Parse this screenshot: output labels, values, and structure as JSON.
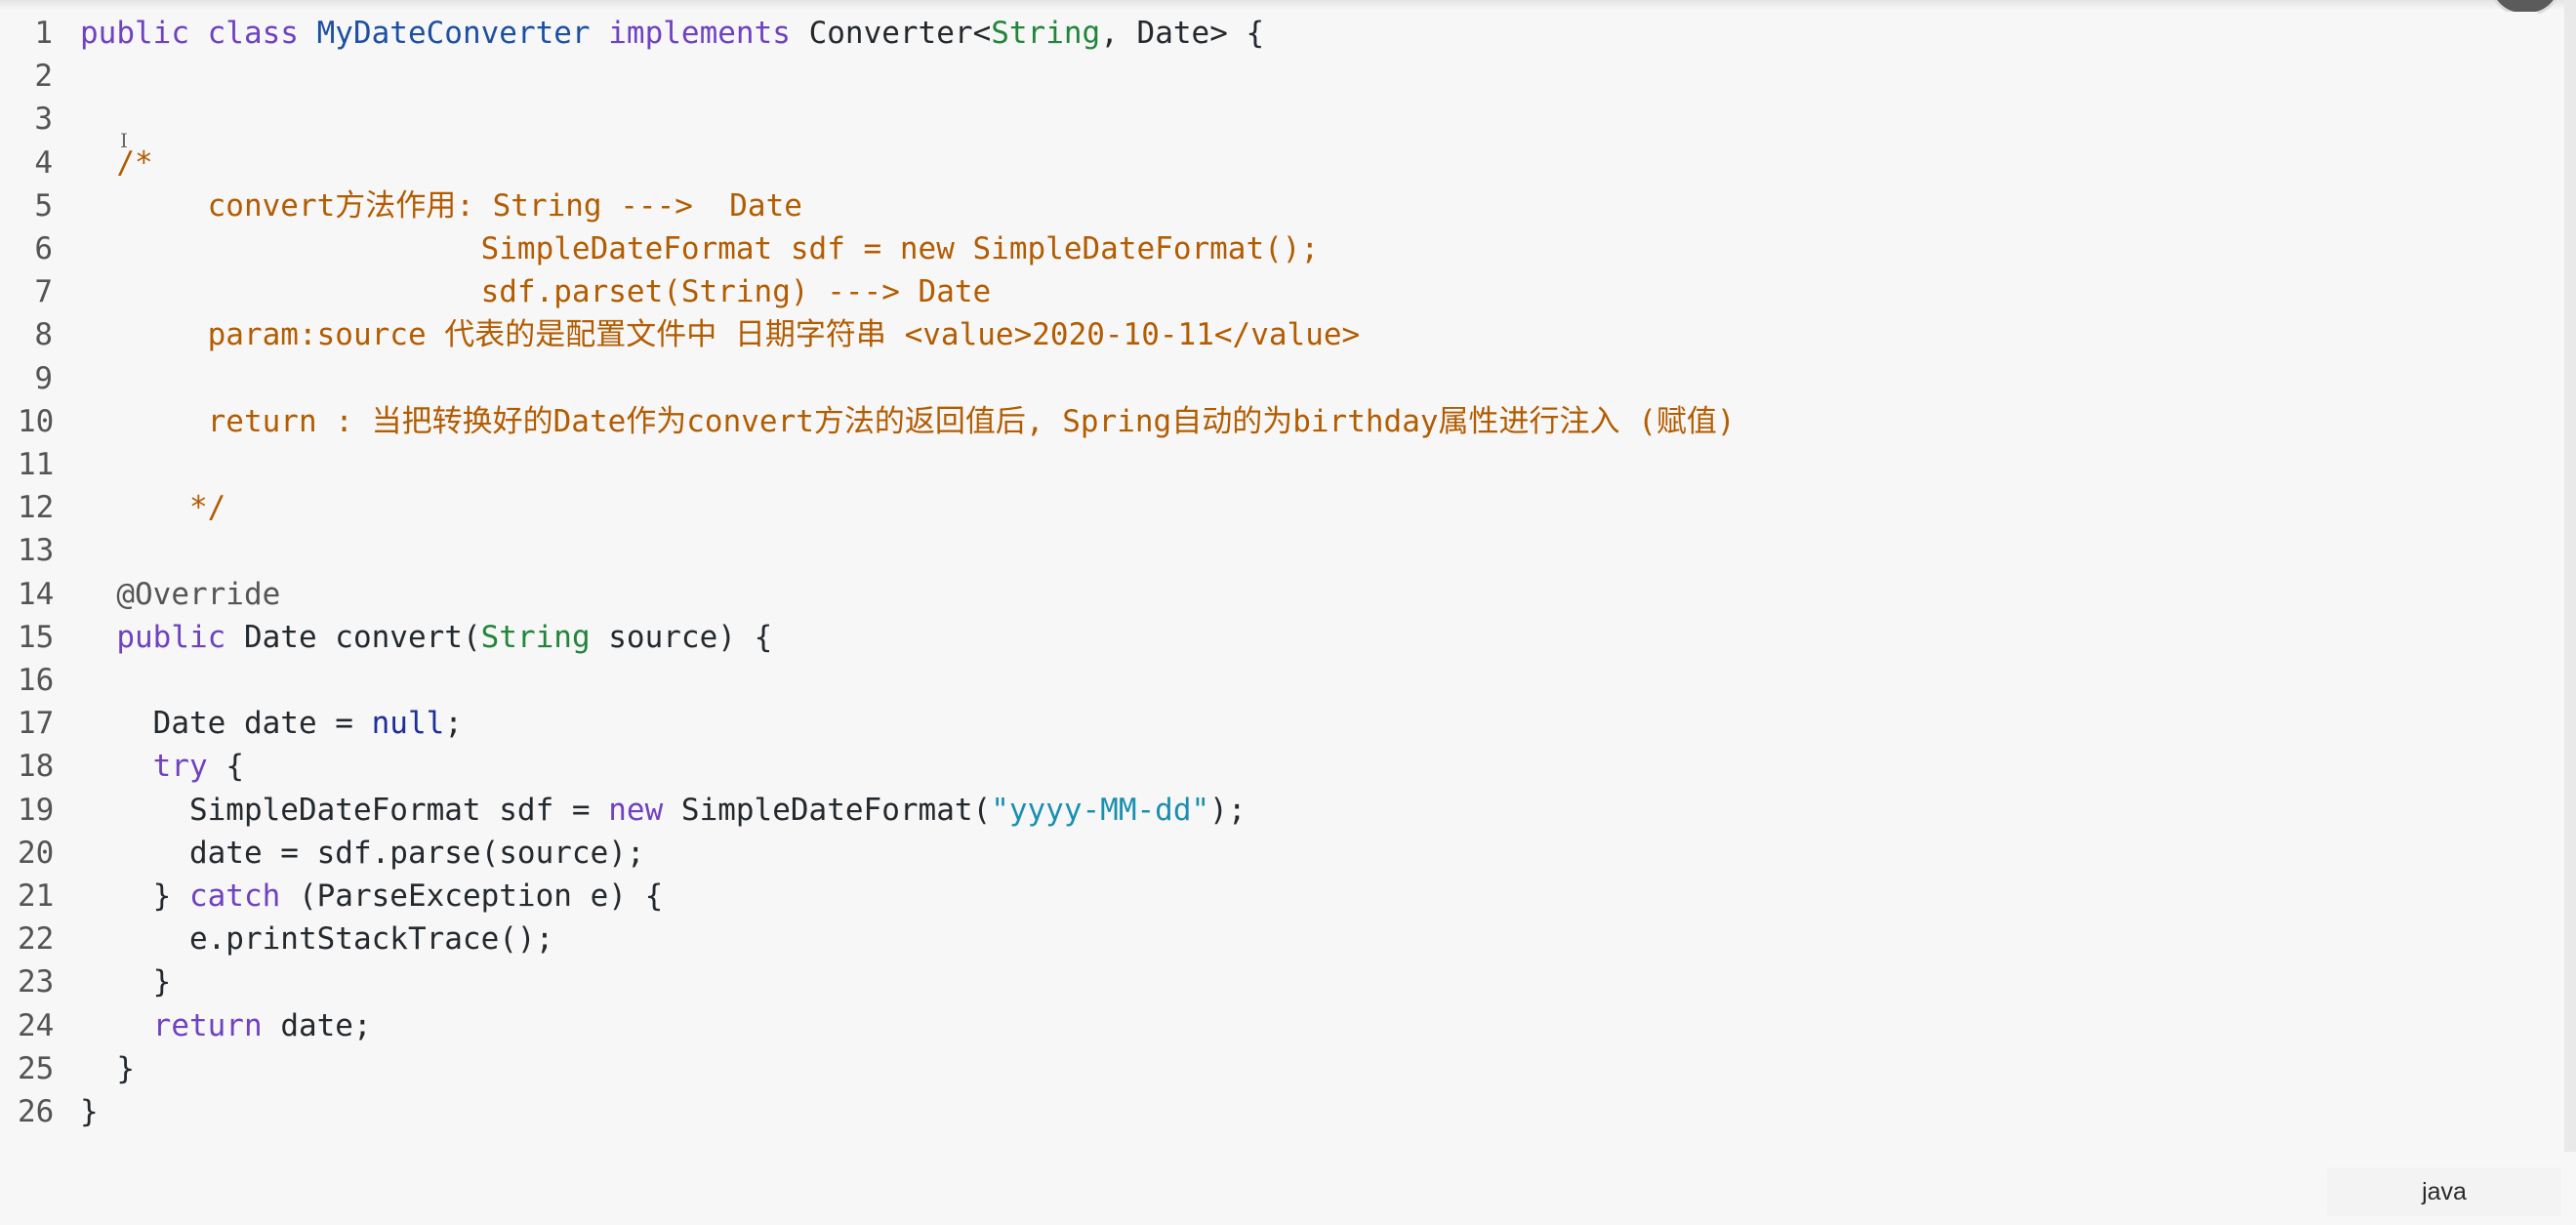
{
  "editor": {
    "language": "java",
    "lines": [
      {
        "n": "1",
        "tokens": [
          [
            "kw",
            "public class "
          ],
          [
            "cls",
            "MyDateConverter "
          ],
          [
            "kw",
            "implements "
          ],
          [
            "plain",
            "Converter"
          ],
          [
            "plain",
            "<"
          ],
          [
            "type",
            "String"
          ],
          [
            "plain",
            ", Date> {"
          ]
        ]
      },
      {
        "n": "2",
        "tokens": []
      },
      {
        "n": "3",
        "tokens": []
      },
      {
        "n": "4",
        "tokens": [
          [
            "cmt",
            "  /*"
          ]
        ]
      },
      {
        "n": "5",
        "tokens": [
          [
            "cmt",
            "       convert方法作用: String --->  Date"
          ]
        ]
      },
      {
        "n": "6",
        "tokens": [
          [
            "cmt",
            "                      SimpleDateFormat sdf = new SimpleDateFormat();"
          ]
        ]
      },
      {
        "n": "7",
        "tokens": [
          [
            "cmt",
            "                      sdf.parset(String) ---> Date"
          ]
        ]
      },
      {
        "n": "8",
        "tokens": [
          [
            "cmt",
            "       param:source 代表的是配置文件中 日期字符串 <value>2020-10-11</value>"
          ]
        ]
      },
      {
        "n": "9",
        "tokens": []
      },
      {
        "n": "10",
        "tokens": [
          [
            "cmt",
            "       return : 当把转换好的Date作为convert方法的返回值后, Spring自动的为birthday属性进行注入 (赋值)"
          ]
        ]
      },
      {
        "n": "11",
        "tokens": []
      },
      {
        "n": "12",
        "tokens": [
          [
            "cmt",
            "      */"
          ]
        ]
      },
      {
        "n": "13",
        "tokens": []
      },
      {
        "n": "14",
        "tokens": [
          [
            "anno",
            "  @Override"
          ]
        ]
      },
      {
        "n": "15",
        "tokens": [
          [
            "kw",
            "  public "
          ],
          [
            "plain",
            "Date convert("
          ],
          [
            "type",
            "String"
          ],
          [
            "plain",
            " source) {"
          ]
        ]
      },
      {
        "n": "16",
        "tokens": []
      },
      {
        "n": "17",
        "tokens": [
          [
            "plain",
            "    Date date = "
          ],
          [
            "lit",
            "null"
          ],
          [
            "plain",
            ";"
          ]
        ]
      },
      {
        "n": "18",
        "tokens": [
          [
            "kw",
            "    try "
          ],
          [
            "plain",
            "{"
          ]
        ]
      },
      {
        "n": "19",
        "tokens": [
          [
            "plain",
            "      SimpleDateFormat sdf = "
          ],
          [
            "kw",
            "new "
          ],
          [
            "plain",
            "SimpleDateFormat("
          ],
          [
            "str",
            "\"yyyy-MM-dd\""
          ],
          [
            "plain",
            ");"
          ]
        ]
      },
      {
        "n": "20",
        "tokens": [
          [
            "plain",
            "      date = sdf.parse(source);"
          ]
        ]
      },
      {
        "n": "21",
        "tokens": [
          [
            "plain",
            "    } "
          ],
          [
            "kw",
            "catch "
          ],
          [
            "plain",
            "(ParseException e) {"
          ]
        ]
      },
      {
        "n": "22",
        "tokens": [
          [
            "plain",
            "      e.printStackTrace();"
          ]
        ]
      },
      {
        "n": "23",
        "tokens": [
          [
            "plain",
            "    }"
          ]
        ]
      },
      {
        "n": "24",
        "tokens": [
          [
            "kw",
            "    return "
          ],
          [
            "plain",
            "date;"
          ]
        ]
      },
      {
        "n": "25",
        "tokens": [
          [
            "plain",
            "  }"
          ]
        ]
      },
      {
        "n": "26",
        "tokens": [
          [
            "plain",
            "}"
          ]
        ]
      }
    ]
  },
  "cursor_glyph": "I"
}
